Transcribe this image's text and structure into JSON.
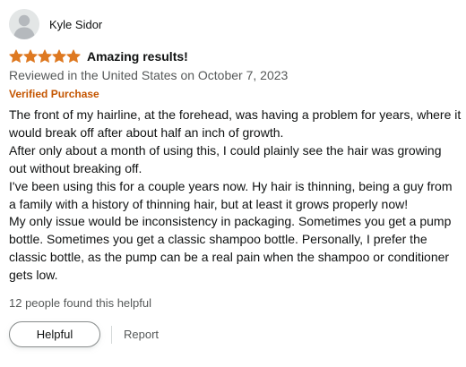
{
  "reviewer": {
    "name": "Kyle Sidor",
    "avatar_icon": "default-profile-icon"
  },
  "rating": {
    "stars": 5,
    "max": 5,
    "star_color": "#de7921"
  },
  "title": "Amazing results!",
  "date_line": "Reviewed in the United States on October 7, 2023",
  "verified_label": "Verified Purchase",
  "body": [
    "The front of my hairline, at the forehead, was having a problem for years, where it would break off after about half an inch of growth.",
    "After only about a month of using this, I could plainly see the hair was growing out without breaking off.",
    "I've been using this for a couple years now. Hy hair is thinning, being a guy from a family with a history of thinning hair, but at least it grows properly now!",
    "My only issue would be inconsistency in packaging. Sometimes you get a pump bottle. Sometimes you get a classic shampoo bottle. Personally, I prefer the classic bottle, as the pump can be a real pain when the shampoo or conditioner gets low."
  ],
  "helpful_count_text": "12 people found this helpful",
  "actions": {
    "helpful_label": "Helpful",
    "report_label": "Report"
  },
  "colors": {
    "verified": "#c45500",
    "muted_text": "#565959",
    "text": "#0f1111"
  }
}
